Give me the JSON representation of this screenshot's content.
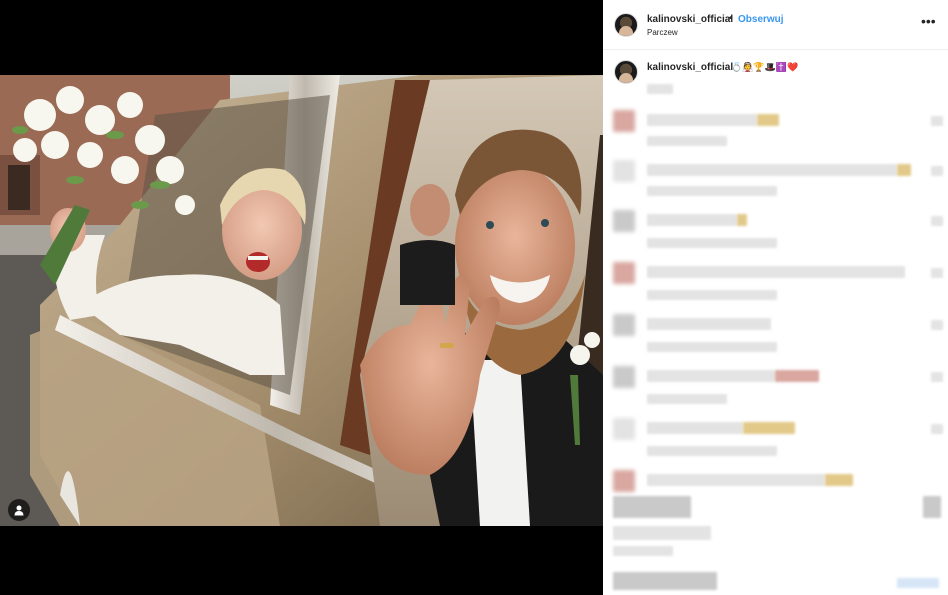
{
  "post": {
    "username": "kalinovski_official",
    "separator": "•",
    "follow_label": "Obserwuj",
    "location": "Parczew",
    "more_label": "•••",
    "caption_username": "kalinovski_official",
    "caption_emojis": "💍👰🏆🎩✝️❤️"
  },
  "icons": {
    "avatar": "avatar",
    "tag": "user-tag-icon",
    "more": "more-options-icon"
  },
  "colors": {
    "accent": "#3897f0",
    "text": "#262626",
    "background": "#000000"
  }
}
